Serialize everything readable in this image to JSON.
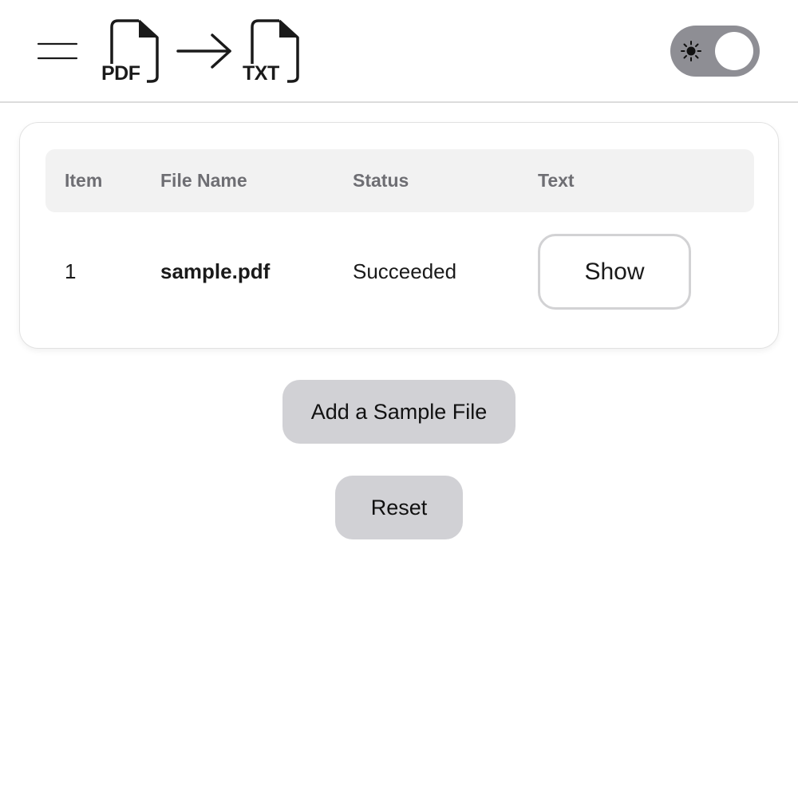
{
  "header": {
    "menu_icon": "hamburger-menu-icon",
    "logo": {
      "from_label": "PDF",
      "to_label": "TXT",
      "from_icon": "document-icon",
      "arrow_icon": "arrow-right-icon",
      "to_icon": "document-icon"
    },
    "theme_toggle": {
      "icon": "sun-icon",
      "state": "light",
      "track_color": "#8e8e94"
    }
  },
  "table": {
    "columns": [
      "Item",
      "File Name",
      "Status",
      "Text"
    ],
    "rows": [
      {
        "item": "1",
        "file_name": "sample.pdf",
        "status": "Succeeded",
        "action_label": "Show"
      }
    ]
  },
  "actions": {
    "add_sample_label": "Add a Sample File",
    "reset_label": "Reset"
  },
  "colors": {
    "button_bg": "#d1d1d5",
    "header_row_bg": "#f2f2f2",
    "header_text": "#6e6e73"
  }
}
